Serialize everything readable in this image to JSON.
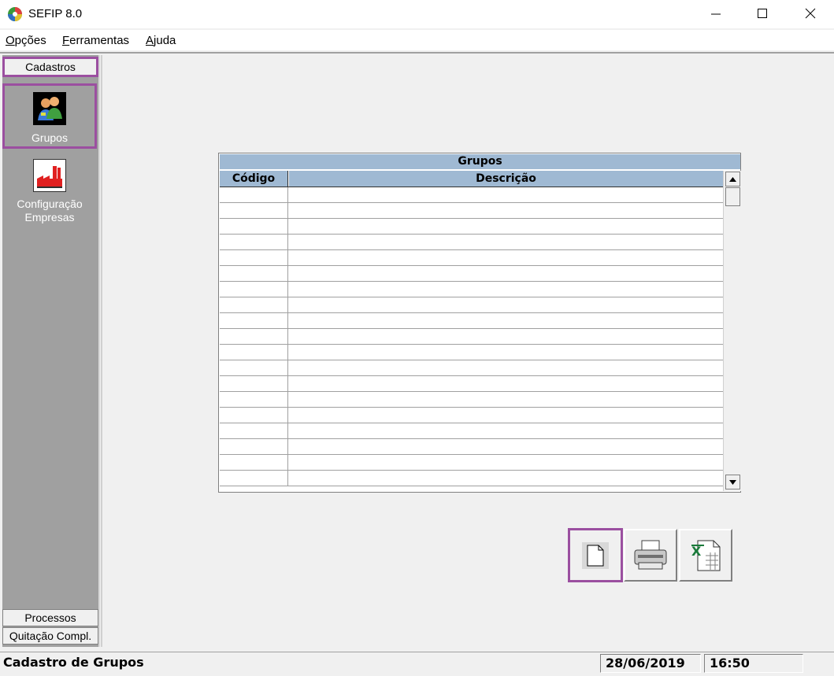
{
  "window": {
    "title": "SEFIP 8.0"
  },
  "menu": [
    {
      "label": "Opções",
      "accel": "O",
      "rest": "pções"
    },
    {
      "label": "Ferramentas",
      "accel": "F",
      "rest": "erramentas"
    },
    {
      "label": "Ajuda",
      "accel": "A",
      "rest": "juda"
    }
  ],
  "sidebar": {
    "top_tab": "Cadastros",
    "items": [
      {
        "label": "Grupos",
        "icon": "groups-icon"
      },
      {
        "label_line1": "Configuração",
        "label_line2": "Empresas",
        "icon": "factory-icon"
      }
    ],
    "bottom_tabs": [
      "Processos",
      "Quitação Compl."
    ]
  },
  "grid": {
    "title": "Grupos",
    "columns": [
      "Código",
      "Descrição"
    ],
    "row_count": 19
  },
  "actions": [
    {
      "name": "new-document",
      "icon": "blank-page-icon"
    },
    {
      "name": "print",
      "icon": "printer-icon"
    },
    {
      "name": "export-excel",
      "icon": "excel-icon"
    }
  ],
  "status": {
    "text": "Cadastro de Grupos",
    "date": "28/06/2019",
    "time": "16:50"
  },
  "colors": {
    "grid_header": "#9fb9d3",
    "sidebar": "#a0a0a0",
    "highlight": "#9b4fa0"
  }
}
